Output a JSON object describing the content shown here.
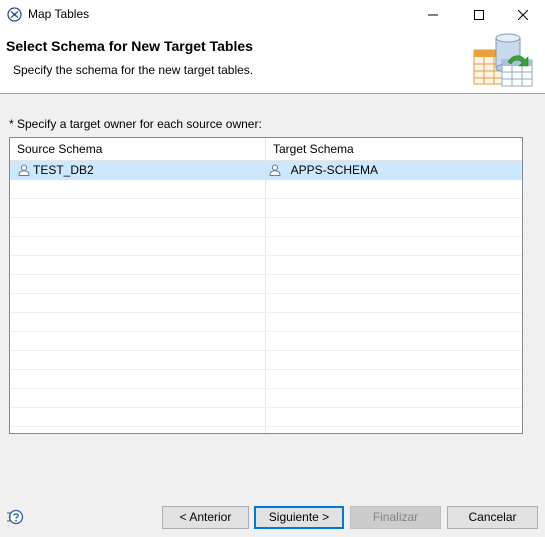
{
  "window": {
    "title": "Map Tables",
    "icons": {
      "app": "map-tables-icon",
      "minimize": "minimize-icon",
      "maximize": "maximize-icon",
      "close": "close-icon"
    }
  },
  "header": {
    "title": "Select Schema for New Target Tables",
    "description": "Specify the schema for the new target tables.",
    "art": "database-tables-graphic"
  },
  "instruction": "* Specify a target owner for each source owner:",
  "table": {
    "columns": [
      "Source Schema",
      "Target Schema"
    ],
    "rows": [
      {
        "source": "TEST_DB2",
        "target": "APPS-SCHEMA",
        "selected": true,
        "icon": "user-icon"
      }
    ],
    "empty_rows": 13
  },
  "footer": {
    "help_icon": "help-icon",
    "back": "< Anterior",
    "next": "Siguiente >",
    "finish": "Finalizar",
    "cancel": "Cancelar",
    "finish_enabled": false
  },
  "colors": {
    "selection": "#cce8ff",
    "default_button_border": "#0078d7",
    "header_bg": "#ffffff",
    "dialog_bg": "#f0f0f0"
  }
}
